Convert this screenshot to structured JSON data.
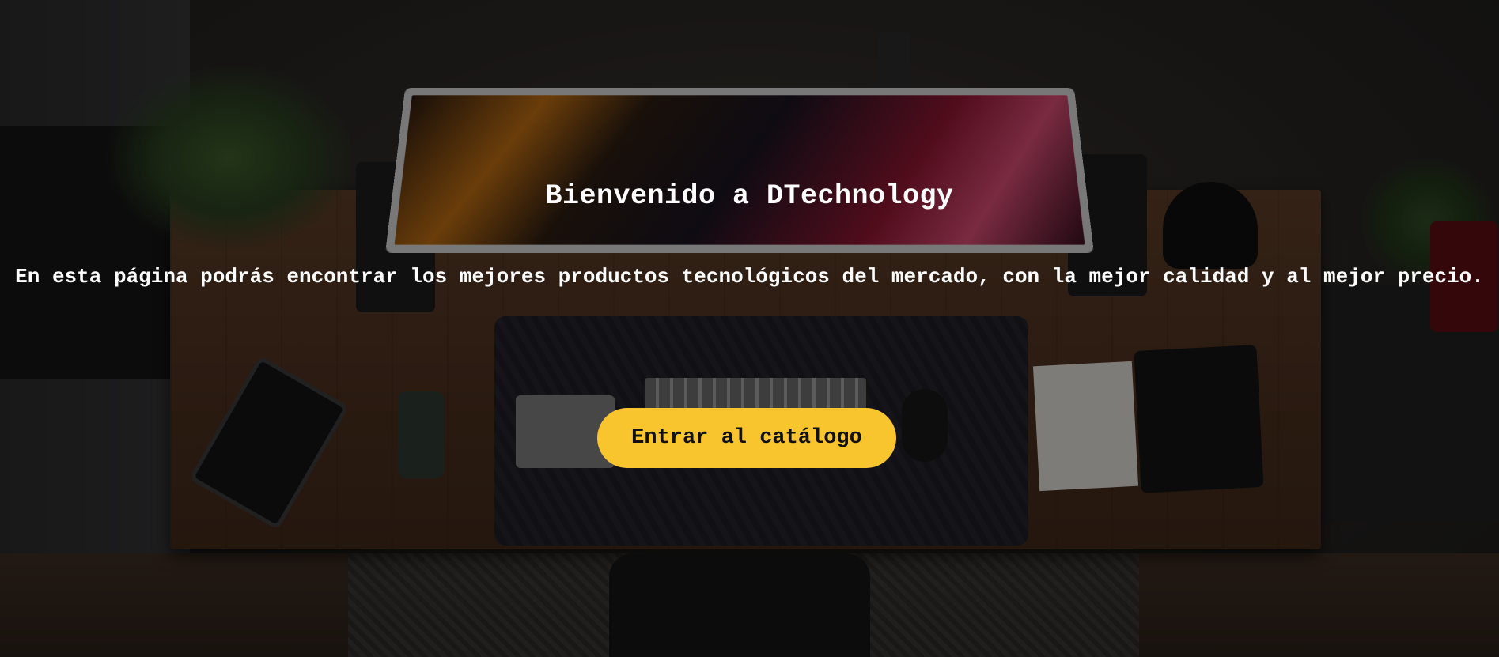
{
  "hero": {
    "title": "Bienvenido a DTechnology",
    "subtitle": "En esta página podrás encontrar los mejores productos tecnológicos del mercado, con la mejor calidad y al mejor precio.",
    "cta_label": "Entrar al catálogo"
  },
  "colors": {
    "cta_background": "#f9c52f",
    "text": "#ffffff"
  }
}
